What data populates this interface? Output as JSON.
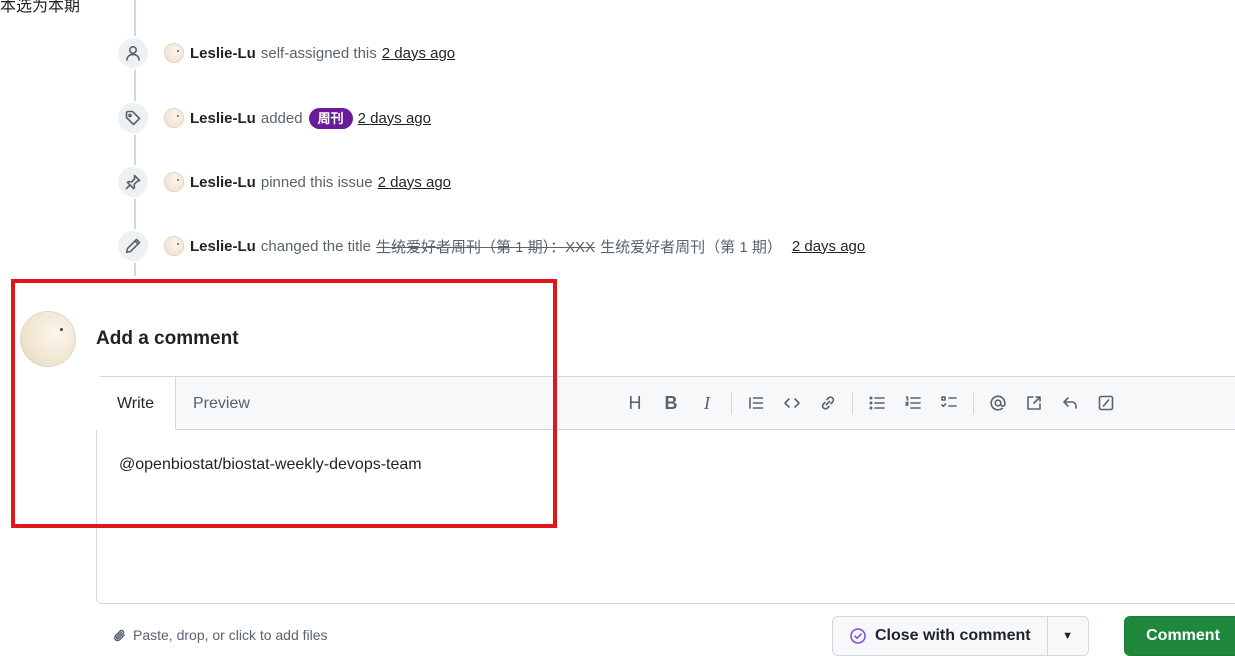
{
  "top_text": "本选为本期",
  "timeline": [
    {
      "author": "Leslie-Lu",
      "action": "self-assigned this",
      "time": "2 days ago",
      "icon": "person-icon"
    },
    {
      "author": "Leslie-Lu",
      "action": "added",
      "label": "周刊",
      "time": "2 days ago",
      "icon": "tag-icon"
    },
    {
      "author": "Leslie-Lu",
      "action": "pinned this issue",
      "time": "2 days ago",
      "icon": "pin-icon"
    },
    {
      "author": "Leslie-Lu",
      "action": "changed the title",
      "old_title": "生统爱好者周刊（第 1 期）：XXX",
      "new_title": "生统爱好者周刊（第 1 期）",
      "time": "2 days ago",
      "icon": "pencil-icon"
    }
  ],
  "comment": {
    "heading": "Add a comment",
    "tabs": {
      "write": "Write",
      "preview": "Preview"
    },
    "toolbar": {
      "heading": "H",
      "bold": "B",
      "italic": "I"
    },
    "body_text": "@openbiostat/biostat-weekly-devops-team",
    "attach_hint": "Paste, drop, or click to add files",
    "close_button": "Close with comment",
    "submit_button": "Comment"
  },
  "colors": {
    "label_bg": "#6a1b9a",
    "submit_bg": "#1f883d",
    "highlight_box": "#e0161a",
    "close_icon": "#8250df"
  }
}
